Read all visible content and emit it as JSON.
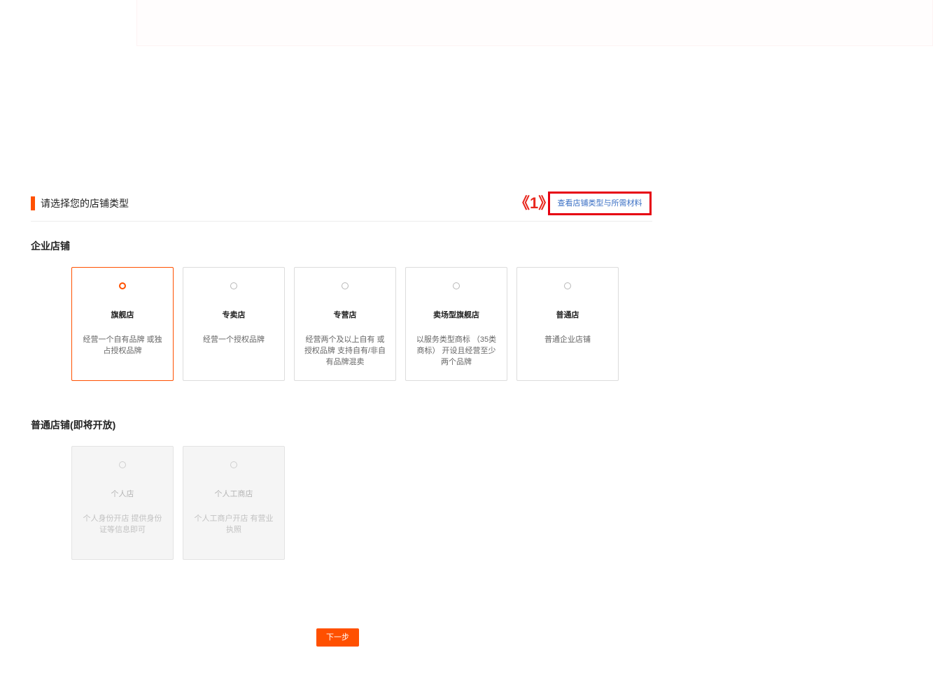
{
  "header": {
    "title": "请选择您的店铺类型",
    "annotation": "《1》",
    "help_link": "查看店铺类型与所需材料"
  },
  "enterprise": {
    "title": "企业店铺",
    "selected_index": 0,
    "cards": [
      {
        "title": "旗舰店",
        "desc": "经营一个自有品牌 或独占授权品牌"
      },
      {
        "title": "专卖店",
        "desc": "经营一个授权品牌"
      },
      {
        "title": "专营店",
        "desc": "经营两个及以上自有 或授权品牌 支持自有/非自有品牌混卖"
      },
      {
        "title": "卖场型旗舰店",
        "desc": "以服务类型商标 （35类商标） 开设且经营至少两个品牌"
      },
      {
        "title": "普通店",
        "desc": "普通企业店铺"
      }
    ]
  },
  "personal": {
    "title": "普通店铺(即将开放)",
    "cards": [
      {
        "title": "个人店",
        "desc": "个人身份开店 提供身份证等信息即可"
      },
      {
        "title": "个人工商店",
        "desc": "个人工商户开店 有营业执照"
      }
    ]
  },
  "footer": {
    "next_label": "下一步"
  },
  "colors": {
    "accent": "#ff5000",
    "link": "#3a6fc4",
    "annotation": "#e60012"
  }
}
